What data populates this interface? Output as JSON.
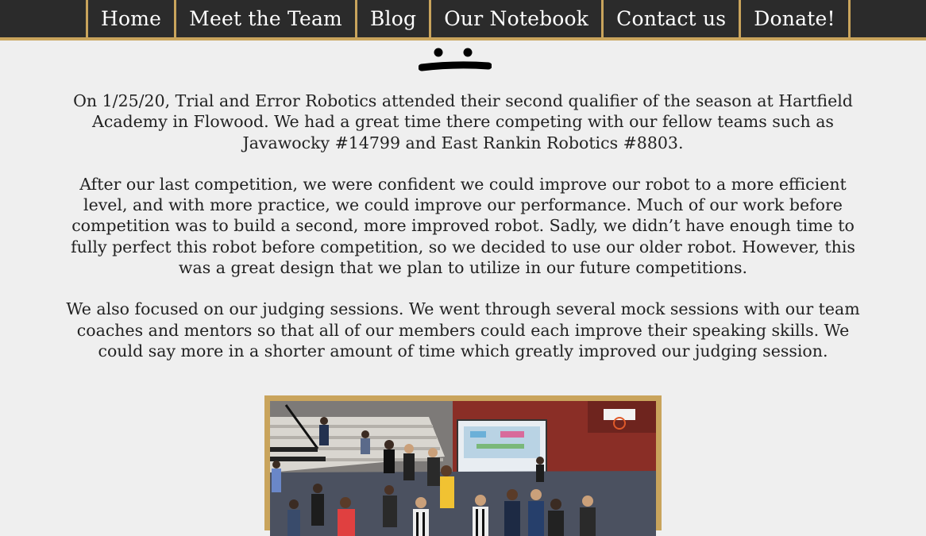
{
  "nav": {
    "items": [
      {
        "label": "Home"
      },
      {
        "label": "Meet the Team"
      },
      {
        "label": "Blog"
      },
      {
        "label": "Our Notebook"
      },
      {
        "label": "Contact us"
      },
      {
        "label": "Donate!"
      }
    ]
  },
  "article": {
    "paragraphs": [
      "On 1/25/20, Trial and Error Robotics attended their second qualifier of the season at Hartfield Academy in Flowood. We had a great time there competing with our fellow teams such as Javawocky #14799 and East Rankin Robotics #8803.",
      "After our last competition, we were confident we could improve our robot to a more efficient level, and with more practice, we could improve our performance. Much of our work before competition was to build a second, more improved robot. Sadly, we didn’t have enough time to fully perfect this robot before competition, so we decided to use our older robot. However, this was a great design that we plan to utilize in our future competitions.",
      "We also focused on our judging sessions. We went through several mock sessions with our team coaches and mentors so that all of our members could each improve their speaking skills. We could say more in a shorter amount of time which greatly improved our judging session."
    ]
  },
  "colors": {
    "navbar": "#2b2b2b",
    "accent_gold": "#c9a45c",
    "background": "#efefef",
    "text": "#222222"
  },
  "icons": {
    "divider": "face-divider-icon"
  }
}
